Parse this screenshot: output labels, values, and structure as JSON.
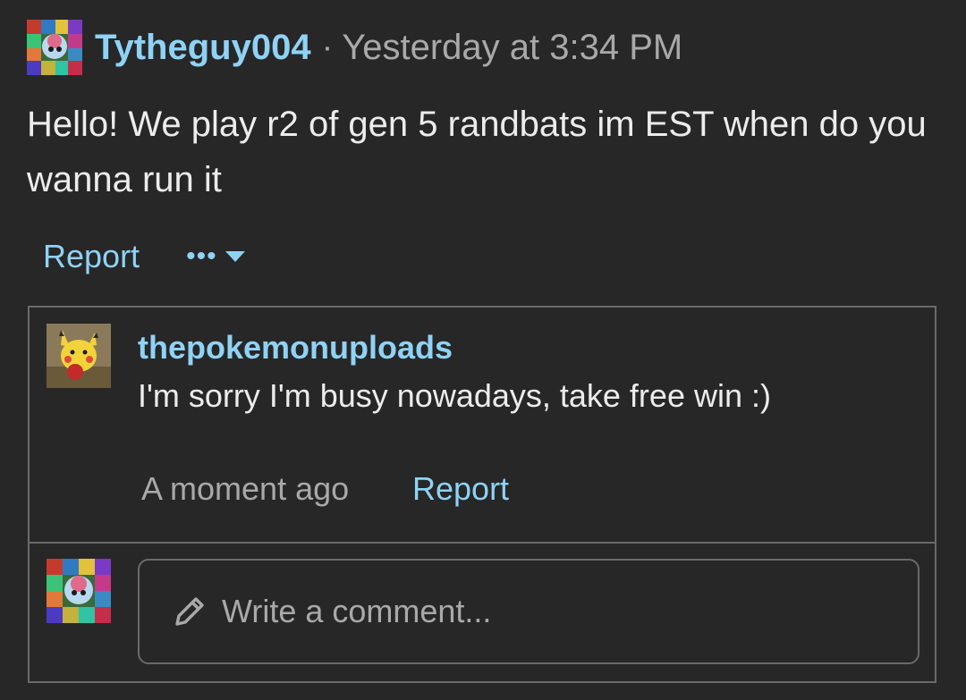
{
  "post": {
    "author": "Tytheguy004",
    "separator": "·",
    "time": "Yesterday at 3:34 PM",
    "body": "Hello! We play r2 of gen 5 randbats im EST when do you wanna run it",
    "report_label": "Report",
    "more_label": "•••"
  },
  "comment": {
    "author": "thepokemonuploads",
    "text": "I'm sorry I'm busy nowadays, take free win :)",
    "time": "A moment ago",
    "report_label": "Report"
  },
  "reply": {
    "placeholder": "Write a comment..."
  },
  "colors": {
    "background": "#272727",
    "link": "#8fd2f5",
    "muted": "#a9a9a9",
    "text": "#ececec",
    "border": "#6a6a6a"
  },
  "icons": {
    "post_avatar": "user-avatar-pokemon-icon",
    "comment_avatar": "pikachu-avatar-icon",
    "reply_avatar": "user-avatar-pokemon-icon",
    "more": "ellipsis-icon",
    "caret": "caret-down-icon",
    "compose": "pencil-icon"
  }
}
